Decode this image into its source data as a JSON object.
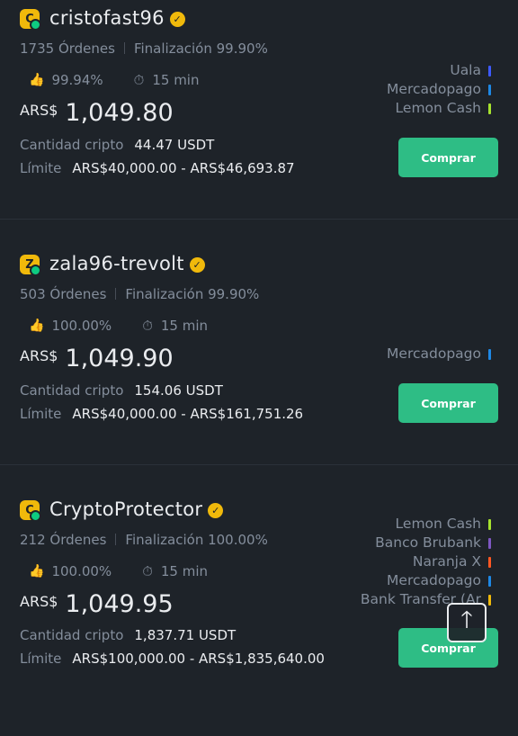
{
  "colors": {
    "background": "#1e2329",
    "buy": "#2ebd85",
    "brand": "#f0b90b"
  },
  "offers": [
    {
      "avatar_letter": "C",
      "name": "cristofast96",
      "orders": "1735 Órdenes",
      "completion": "Finalización 99.90%",
      "rating": "99.94%",
      "time": "15 min",
      "currency": "ARS$",
      "price": "1,049.80",
      "amount_label": "Cantidad cripto",
      "amount": "44.47 USDT",
      "limit_label": "Límite",
      "limit": "ARS$40,000.00 - ARS$46,693.87",
      "payments": [
        {
          "name": "Uala",
          "color": "#3d5afe"
        },
        {
          "name": "Mercadopago",
          "color": "#1e88e5"
        },
        {
          "name": "Lemon Cash",
          "color": "#a6e22e"
        }
      ],
      "button": "Comprar"
    },
    {
      "avatar_letter": "Z",
      "name": "zala96-trevolt",
      "orders": "503 Órdenes",
      "completion": "Finalización 99.90%",
      "rating": "100.00%",
      "time": "15 min",
      "currency": "ARS$",
      "price": "1,049.90",
      "amount_label": "Cantidad cripto",
      "amount": "154.06 USDT",
      "limit_label": "Límite",
      "limit": "ARS$40,000.00 - ARS$161,751.26",
      "payments": [
        {
          "name": "Mercadopago",
          "color": "#1e88e5"
        }
      ],
      "button": "Comprar"
    },
    {
      "avatar_letter": "C",
      "name": "CryptoProtector",
      "orders": "212 Órdenes",
      "completion": "Finalización 100.00%",
      "rating": "100.00%",
      "time": "15 min",
      "currency": "ARS$",
      "price": "1,049.95",
      "amount_label": "Cantidad cripto",
      "amount": "1,837.71 USDT",
      "limit_label": "Límite",
      "limit": "ARS$100,000.00 - ARS$1,835,640.00",
      "payments": [
        {
          "name": "Lemon Cash",
          "color": "#a6e22e"
        },
        {
          "name": "Banco Brubank",
          "color": "#7e57c2"
        },
        {
          "name": "Naranja X",
          "color": "#ff5722"
        },
        {
          "name": "Mercadopago",
          "color": "#1e88e5"
        },
        {
          "name": "Bank Transfer (Ar",
          "color": "#f0b90b"
        }
      ],
      "button": "Comprar"
    }
  ],
  "scroll_top_icon": "arrow-up-icon"
}
